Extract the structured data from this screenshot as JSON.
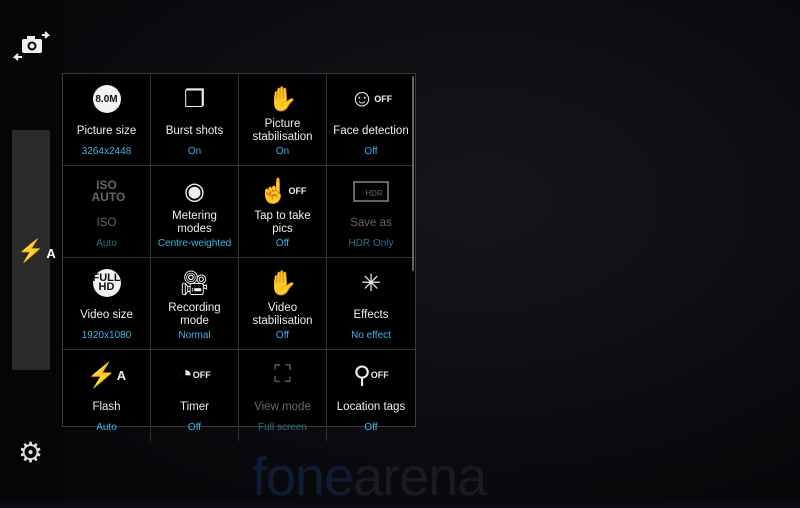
{
  "settings": [
    {
      "label": "Picture size",
      "value": "3264x2448",
      "icon": "picture-size-icon",
      "icon_text": "8.0M",
      "enabled": true
    },
    {
      "label": "Burst shots",
      "value": "On",
      "icon": "burst-shots-icon",
      "enabled": true
    },
    {
      "label": "Picture stabilisation",
      "value": "On",
      "icon": "hand-stabilisation-icon",
      "enabled": true
    },
    {
      "label": "Face detection",
      "value": "Off",
      "icon": "face-detection-off-icon",
      "enabled": true
    },
    {
      "label": "ISO",
      "value": "Auto",
      "icon": "iso-auto-icon",
      "icon_text": "ISO AUTO",
      "enabled": false
    },
    {
      "label": "Metering modes",
      "value": "Centre-weighted",
      "icon": "metering-icon",
      "enabled": true
    },
    {
      "label": "Tap to take pics",
      "value": "Off",
      "icon": "tap-off-icon",
      "enabled": true
    },
    {
      "label": "Save as",
      "value": "HDR Only",
      "icon": "hdr-icon",
      "icon_text": "HDR",
      "enabled": false
    },
    {
      "label": "Video size",
      "value": "1920x1080",
      "icon": "full-hd-icon",
      "icon_text": "FULL HD",
      "enabled": true
    },
    {
      "label": "Recording mode",
      "value": "Normal",
      "icon": "video-camera-icon",
      "enabled": true
    },
    {
      "label": "Video stabilisation",
      "value": "Off",
      "icon": "video-stabilisation-off-icon",
      "enabled": true
    },
    {
      "label": "Effects",
      "value": "No effect",
      "icon": "magic-wand-icon",
      "enabled": true
    },
    {
      "label": "Flash",
      "value": "Auto",
      "icon": "flash-auto-icon",
      "icon_text": "A",
      "enabled": true
    },
    {
      "label": "Timer",
      "value": "Off",
      "icon": "timer-off-icon",
      "enabled": true
    },
    {
      "label": "View mode",
      "value": "Full screen",
      "icon": "full-screen-icon",
      "enabled": false
    },
    {
      "label": "Location tags",
      "value": "Off",
      "icon": "location-off-icon",
      "enabled": true
    }
  ],
  "off_text": "OFF",
  "sidebar": {
    "flash_mode": "A",
    "switch_camera": "camera-switch-icon",
    "settings": "gear-icon"
  },
  "watermark": {
    "part1": "fone",
    "part2": "arena"
  },
  "colors": {
    "value": "#3fb6e6",
    "panel": "#2b2b2b"
  }
}
